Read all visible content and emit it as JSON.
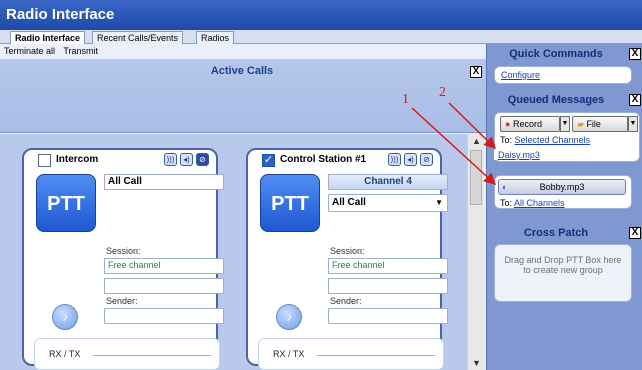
{
  "window": {
    "title": "Radio Interface"
  },
  "tabs": [
    {
      "label": "Radio Interface"
    },
    {
      "label": "Recent Calls/Events"
    },
    {
      "label": "Radios"
    }
  ],
  "toolbar": {
    "terminate_all": "Terminate all",
    "transmit": "Transmit"
  },
  "active_calls": {
    "title": "Active Calls",
    "close_label": "X"
  },
  "cards": [
    {
      "name": "Intercom",
      "checked": false,
      "ptt_label": "PTT",
      "call": "All Call",
      "session_label": "Session:",
      "session_value": "Free channel",
      "sender_label": "Sender:",
      "rxtx_label": "RX / TX"
    },
    {
      "name": "Control Station #1",
      "checked": true,
      "ptt_label": "PTT",
      "channel": "Channel 4",
      "call": "All Call",
      "session_label": "Session:",
      "session_value": "Free channel",
      "sender_label": "Sender:",
      "rxtx_label": "RX / TX"
    }
  ],
  "sidebar": {
    "quick_commands": {
      "title": "Quick Commands",
      "configure": "Configure"
    },
    "queued_messages": {
      "title": "Queued Messages",
      "record_label": "Record",
      "file_label": "File",
      "to_prefix": "To:",
      "selected_channels": "Selected Channels",
      "daisy_file": "Daisy.mp3",
      "bobby_file": "Bobby.mp3",
      "all_channels": "All Channels"
    },
    "cross_patch": {
      "title": "Cross Patch",
      "hint": "Drag and Drop PTT Box here to create new group"
    }
  },
  "annotations": [
    "1",
    "2"
  ],
  "colors": {
    "titlebar": "#2552b8",
    "annotation": "#d21c1c",
    "ptt": "#2c6ae0"
  }
}
